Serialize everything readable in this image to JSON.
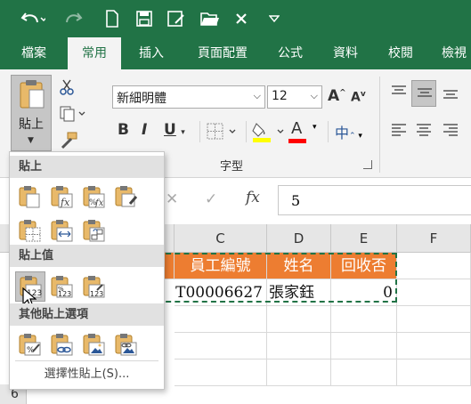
{
  "colors": {
    "brand": "#217346",
    "header_fill": "#ed7d31",
    "font_color": "#ff0000",
    "highlight": "#ffff00"
  },
  "qat": {
    "items": [
      "undo-icon",
      "redo-icon",
      "new-file-icon",
      "save-icon",
      "save-as-icon",
      "open-folder-icon",
      "close-x-icon",
      "customize-qat-icon"
    ]
  },
  "ribbon": {
    "tabs": [
      "檔案",
      "常用",
      "插入",
      "頁面配置",
      "公式",
      "資料",
      "校閱",
      "檢視"
    ],
    "active_tab": "常用",
    "paste_label": "貼上",
    "font_name": "新細明體",
    "font_size": "12",
    "font_group_label": "字型",
    "bold": "B",
    "italic": "I",
    "underline": "U",
    "font_color_glyph": "A",
    "phonetic_glyph": "中",
    "grow_glyph": "A",
    "shrink_glyph": "A"
  },
  "formula_bar": {
    "fx": "fx",
    "value": "5"
  },
  "sheet": {
    "columns": [
      "C",
      "D",
      "E",
      "F"
    ],
    "headers": [
      "員工編號",
      "姓名",
      "回收否"
    ],
    "row": [
      "T00006627",
      "張家鈺",
      "0"
    ],
    "row_number": "6"
  },
  "paste_menu": {
    "section_paste": "貼上",
    "section_values": "貼上值",
    "section_other": "其他貼上選項",
    "special_link": "選擇性貼上(S)..."
  }
}
